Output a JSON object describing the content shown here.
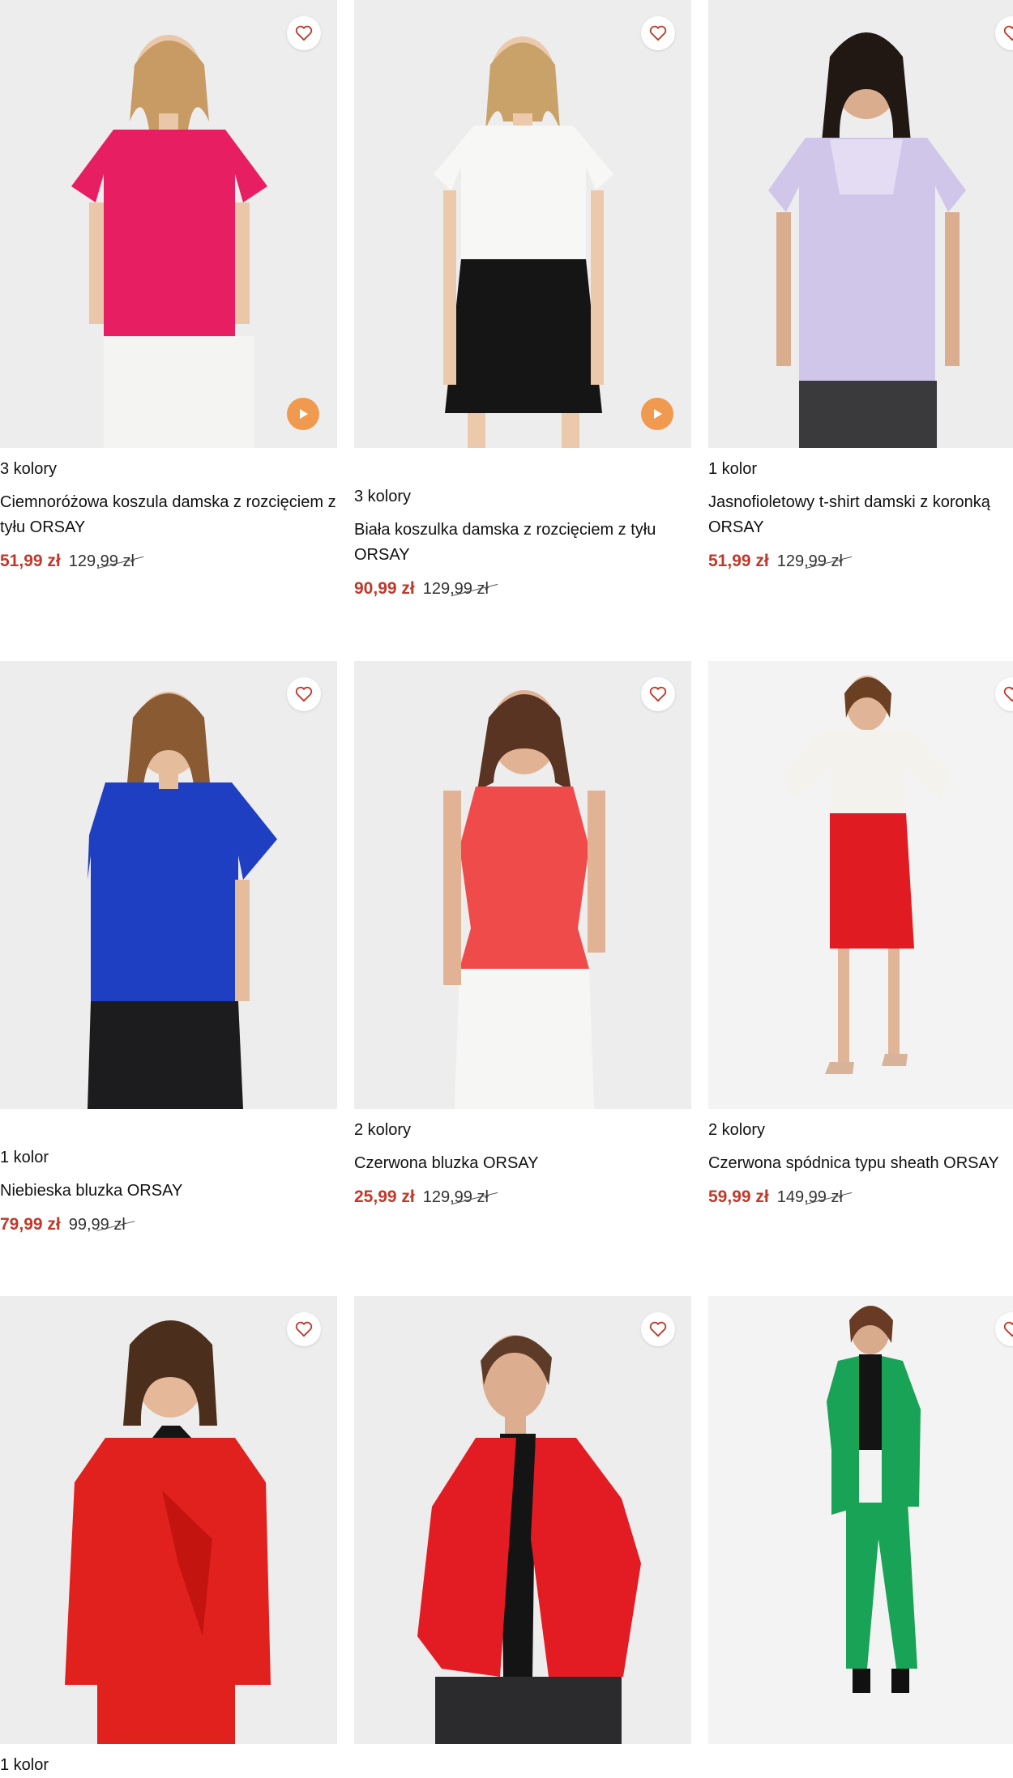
{
  "products": [
    {
      "colors": "3 kolory",
      "title": "Ciemnoróżowa koszula damska z rozcięciem z tyłu ORSAY",
      "price": "51,99 zł",
      "old_price": "129,99 zł",
      "has_video": true,
      "garment_color": "#e81e63"
    },
    {
      "colors": "3 kolory",
      "title": "Biała koszulka damska z rozcięciem z tyłu ORSAY",
      "price": "90,99 zł",
      "old_price": "129,99 zł",
      "has_video": true,
      "garment_color": "#f5f5f3"
    },
    {
      "colors": "1 kolor",
      "title": "Jasnofioletowy t-shirt damski z koronką ORSAY",
      "price": "51,99 zł",
      "old_price": "129,99 zł",
      "has_video": false,
      "garment_color": "#cfc6ea"
    },
    {
      "colors": "1 kolor",
      "title": "Niebieska bluzka ORSAY",
      "price": "79,99 zł",
      "old_price": "99,99 zł",
      "has_video": false,
      "garment_color": "#1f3fc2"
    },
    {
      "colors": "2 kolory",
      "title": "Czerwona bluzka ORSAY",
      "price": "25,99 zł",
      "old_price": "129,99 zł",
      "has_video": false,
      "garment_color": "#ef4b4b"
    },
    {
      "colors": "2 kolory",
      "title": "Czerwona spódnica typu sheath ORSAY",
      "price": "59,99 zł",
      "old_price": "149,99 zł",
      "has_video": false,
      "garment_color": "#e01b22"
    },
    {
      "colors": "1 kolor",
      "title": "",
      "price": "",
      "old_price": "",
      "has_video": false,
      "garment_color": "#e0211e"
    },
    {
      "colors": "",
      "title": "",
      "price": "",
      "old_price": "",
      "has_video": false,
      "garment_color": "#e31c23"
    },
    {
      "colors": "",
      "title": "",
      "price": "",
      "old_price": "",
      "has_video": false,
      "garment_color": "#1aa25a"
    }
  ],
  "icons": {
    "favorite": "heart-icon",
    "video": "play-icon"
  },
  "colors": {
    "sale_price": "#c0392b",
    "play_button": "#ef9a4f",
    "heart": "#c0392b"
  }
}
